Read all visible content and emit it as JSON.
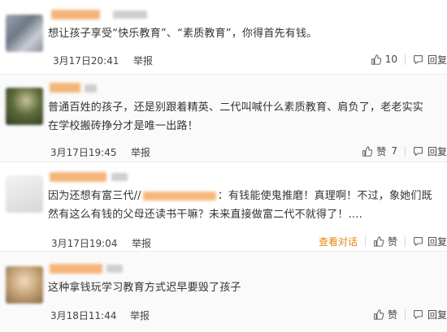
{
  "comments": [
    {
      "text": "想让孩子享受“快乐教育”、“素质教育”，你得首先有钱。",
      "time": "3月17日20:41",
      "report": "举报",
      "like_count": "10",
      "reply": "回复"
    },
    {
      "text": "普通百姓的孩子，还是别跟着精英、二代叫喊什么素质教育、肩负了，老老实实在学校搬砖挣分才是唯一出路！",
      "time": "3月17日19:45",
      "report": "举报",
      "like_label": "赞",
      "like_count": "7",
      "reply": "回复"
    },
    {
      "text_before": "因为还想有富三代//",
      "text_after": "：有钱能使鬼推磨！真理啊！不过，象她们既然有这么有钱的父母还读书干嘛？未来直接做富二代不就得了！....",
      "time": "3月17日19:04",
      "report": "举报",
      "view_conversation": "查看对话",
      "like_label": "赞",
      "reply": "回复"
    },
    {
      "text": "这种拿钱玩学习教育方式迟早要毁了孩子",
      "time": "3月18日11:44",
      "report": "举报",
      "like_label": "赞",
      "reply": "回复"
    }
  ],
  "icons": {
    "like": "thumbs-up-icon",
    "reply": "comment-bubble-icon"
  },
  "colors": {
    "accent": "#e8850c",
    "text": "#333333",
    "muted": "#444444"
  }
}
